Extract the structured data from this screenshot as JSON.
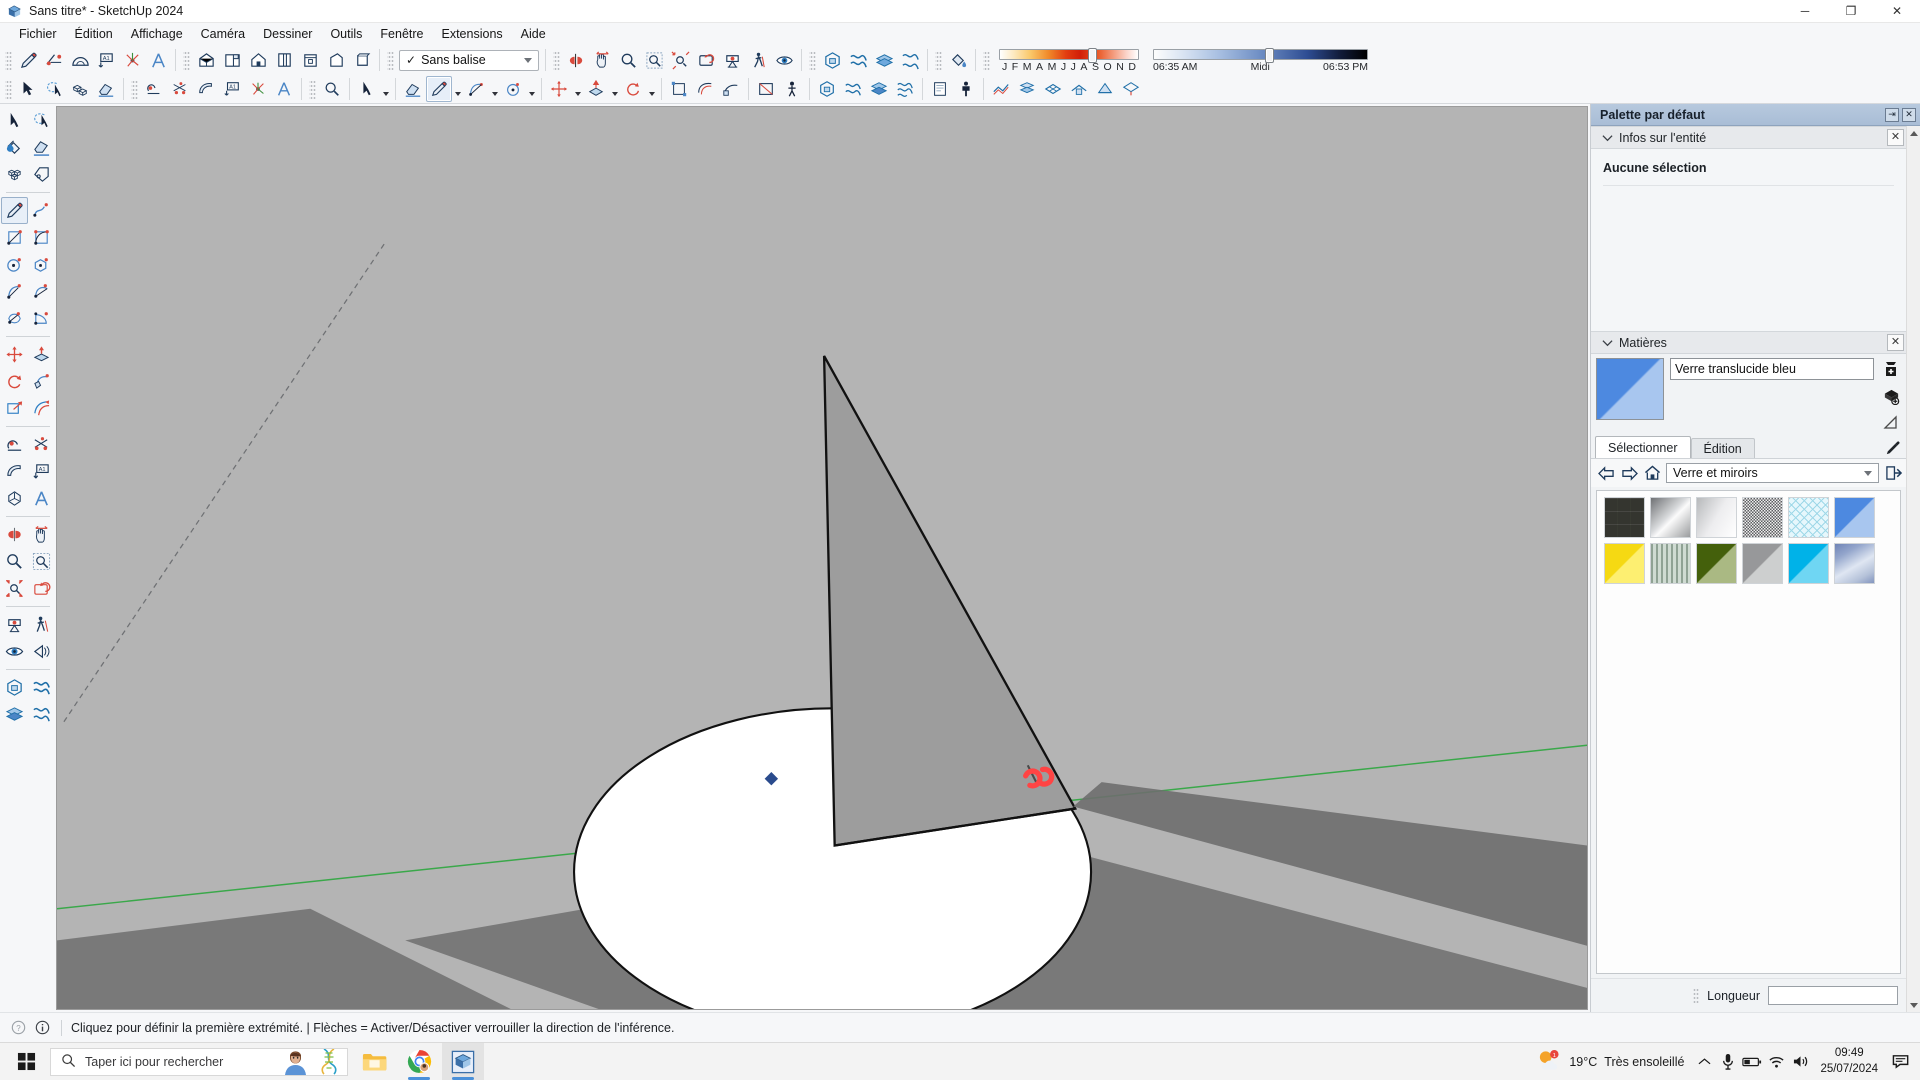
{
  "window": {
    "title": "Sans titre* - SketchUp 2024",
    "app_icon": "sketchup-logo-icon",
    "minimize_label": "─",
    "maximize_label": "❐",
    "close_label": "✕"
  },
  "menu": {
    "items": [
      {
        "label": "Fichier"
      },
      {
        "label": "Édition"
      },
      {
        "label": "Affichage"
      },
      {
        "label": "Caméra"
      },
      {
        "label": "Dessiner"
      },
      {
        "label": "Outils"
      },
      {
        "label": "Fenêtre"
      },
      {
        "label": "Extensions"
      },
      {
        "label": "Aide"
      }
    ]
  },
  "toolbar": {
    "tag_selector": {
      "value": "Sans balise",
      "check": "✓"
    },
    "shadows": {
      "month_ticks": [
        "J",
        "F",
        "M",
        "A",
        "M",
        "J",
        "J",
        "A",
        "S",
        "O",
        "N",
        "D"
      ],
      "month_value": 8,
      "sunrise": "06:35 AM",
      "noon": "Midi",
      "sunset": "06:53 PM",
      "time_value": 52
    },
    "row1_icons": [
      "pencil-tool-icon",
      "tape-measure-icon",
      "protractor-icon",
      "axes-icon",
      "dimension-icon",
      "text-3d-icon",
      "section-plane-icon",
      "iso-view-icon",
      "top-view-icon",
      "front-view-icon",
      "right-view-icon",
      "back-view-icon",
      "left-view-icon",
      "bottom-view-icon",
      "flip-icon",
      "pan-icon",
      "zoom-icon",
      "zoom-window-icon",
      "zoom-extents-icon",
      "previous-view-icon",
      "position-camera-icon",
      "walk-icon",
      "look-around-icon",
      "xray-icon",
      "back-edges-icon",
      "wireframe-icon",
      "hidden-line-icon",
      "paint-bucket-icon"
    ],
    "row2_icons": [
      "select-icon",
      "lasso-select-icon",
      "make-component-icon",
      "eraser-icon",
      "paint-icon",
      "line-icon",
      "freehand-icon",
      "rectangle-icon",
      "rotated-rect-icon",
      "circle-icon",
      "polygon-icon",
      "arc-icon",
      "two-point-arc-icon",
      "pie-icon",
      "move-icon",
      "push-pull-icon",
      "rotate-icon",
      "follow-me-icon",
      "scale-icon",
      "offset-icon",
      "tape-icon",
      "dimension-icon",
      "protractor-icon",
      "text-icon",
      "axes-icon",
      "3d-text-icon"
    ]
  },
  "left_toolbar": {
    "active_tool": "line-tool",
    "groups": [
      {
        "tools": [
          {
            "name": "select-icon"
          },
          {
            "name": "lasso-select-icon"
          },
          {
            "name": "make-component-icon"
          },
          {
            "name": "eraser-icon"
          },
          {
            "name": "paint-bucket-icon"
          },
          {
            "name": "tag-icon"
          }
        ]
      },
      {
        "tools": [
          {
            "name": "line-tool-icon",
            "active": true
          },
          {
            "name": "freehand-icon"
          },
          {
            "name": "rectangle-icon"
          },
          {
            "name": "rotated-rectangle-icon"
          },
          {
            "name": "circle-icon"
          },
          {
            "name": "polygon-icon"
          },
          {
            "name": "arc-icon"
          },
          {
            "name": "two-point-arc-icon"
          },
          {
            "name": "three-point-arc-icon"
          },
          {
            "name": "pie-icon"
          }
        ]
      },
      {
        "tools": [
          {
            "name": "move-icon"
          },
          {
            "name": "push-pull-icon"
          },
          {
            "name": "rotate-icon"
          },
          {
            "name": "follow-me-icon"
          },
          {
            "name": "scale-icon"
          },
          {
            "name": "offset-icon"
          },
          {
            "name": "tape-measure-icon"
          },
          {
            "name": "protractor-icon"
          }
        ]
      },
      {
        "tools": [
          {
            "name": "dimension-icon"
          },
          {
            "name": "text-icon"
          },
          {
            "name": "axes-icon"
          },
          {
            "name": "3d-text-icon"
          }
        ]
      },
      {
        "tools": [
          {
            "name": "orbit-icon"
          },
          {
            "name": "pan-icon"
          },
          {
            "name": "zoom-icon"
          },
          {
            "name": "zoom-window-icon"
          },
          {
            "name": "zoom-extents-icon"
          },
          {
            "name": "previous-view-icon"
          }
        ]
      },
      {
        "tools": [
          {
            "name": "position-camera-icon"
          },
          {
            "name": "walk-icon"
          },
          {
            "name": "look-around-icon"
          },
          {
            "name": "section-plane-icon"
          }
        ]
      },
      {
        "tools": [
          {
            "name": "xray-icon"
          },
          {
            "name": "wireframe-icon"
          },
          {
            "name": "hidden-line-icon"
          },
          {
            "name": "shaded-icon"
          }
        ]
      }
    ]
  },
  "palette": {
    "title": "Palette par défaut",
    "pin_label": "⇥",
    "close_label": "✕",
    "entity_info": {
      "header": "Infos sur l'entité",
      "status": "Aucune sélection",
      "close_label": "✕"
    },
    "materials": {
      "header": "Matières",
      "close_label": "✕",
      "current_name": "Verre translucide bleu",
      "current_swatch_color": "#4d89e0",
      "create_material_icon": "create-material-icon",
      "sample_icon": "material-sample-icon",
      "eyedropper_icon": "eyedropper-icon",
      "tabs": [
        {
          "label": "Sélectionner",
          "selected": true
        },
        {
          "label": "Édition",
          "selected": false
        }
      ],
      "nav": {
        "back_icon": "arrow-left-icon",
        "forward_icon": "arrow-right-icon",
        "home_icon": "home-icon",
        "collection": "Verre et miroirs",
        "details_icon": "details-icon"
      },
      "swatches": [
        {
          "name": "verre-quadrille",
          "type": "grid-pattern",
          "c1": "#8d8f86",
          "c2": "#c8cac2"
        },
        {
          "name": "miroir-gris",
          "type": "gradient",
          "c1": "#6f7174",
          "c2": "#fbfbfb"
        },
        {
          "name": "miroir-clair",
          "type": "gradient",
          "c1": "#b7b9bb",
          "c2": "#ffffff"
        },
        {
          "name": "verre-givre",
          "type": "noise",
          "c1": "#6a6c6f",
          "c2": "#eeeeee"
        },
        {
          "name": "verre-treillis",
          "type": "crosshatch",
          "c1": "#9fd8e8",
          "c2": "#e6f7fc"
        },
        {
          "name": "verre-translucide-bleu",
          "type": "diagonal",
          "c1": "#4d89e0",
          "c2": "#a8c6ef"
        },
        {
          "name": "verre-jaune",
          "type": "diagonal",
          "c1": "#f5d913",
          "c2": "#fdef71"
        },
        {
          "name": "verre-raye-vert",
          "type": "stripes",
          "c1": "#8fa294",
          "c2": "#dfe7e0"
        },
        {
          "name": "verre-vert-fonce",
          "type": "diagonal",
          "c1": "#44600b",
          "c2": "#aab983"
        },
        {
          "name": "verre-gris",
          "type": "diagonal",
          "c1": "#97989a",
          "c2": "#cdcfcf"
        },
        {
          "name": "verre-cyan",
          "type": "diagonal",
          "c1": "#00b2e8",
          "c2": "#6fd6f3"
        },
        {
          "name": "verre-nuageux",
          "type": "clouds",
          "c1": "#7f92bd",
          "c2": "#dfe6f2"
        }
      ],
      "length": {
        "label": "Longueur",
        "value": ""
      }
    }
  },
  "viewport": {
    "background_color": "#b4b4b4",
    "ground_color": "#b4b4b4",
    "green_axis_color": "#3aa84a",
    "cone_fill": "#9d9d9d",
    "circle_fill": "#ffffff",
    "shadow_color": "#6e6e6e",
    "cursor_marker": "line-tool-cursor",
    "origin_point": "origin-point"
  },
  "status_bar": {
    "help_icon": "help-icon",
    "info_icon": "info-icon",
    "message": "Cliquez pour définir la première extrémité. | Flèches = Activer/Désactiver verrouiller la direction de l'inférence."
  },
  "taskbar": {
    "start_icon": "windows-start-icon",
    "search": {
      "placeholder": "Taper ici pour rechercher",
      "icon": "search-icon",
      "avatar_icon": "avatar-icon",
      "dna_icon": "dna-icon"
    },
    "apps": [
      {
        "name": "file-explorer-icon"
      },
      {
        "name": "google-chrome-icon"
      },
      {
        "name": "sketchup-app-icon"
      }
    ],
    "tray": {
      "weather_temp": "19°C",
      "weather_desc": "Très ensoleillé",
      "weather_icon": "sun-cloud-icon",
      "chevron_icon": "chevron-up-icon",
      "mic_icon": "microphone-icon",
      "battery_icon": "battery-icon",
      "wifi_icon": "wifi-icon",
      "volume_icon": "volume-icon",
      "time": "09:49",
      "date": "25/07/2024",
      "notification_icon": "notification-icon"
    }
  }
}
